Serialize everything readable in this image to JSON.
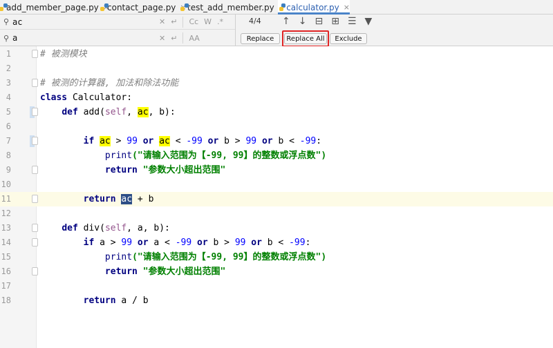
{
  "tabs": [
    {
      "label": "add_member_page.py",
      "close": "×"
    },
    {
      "label": "contact_page.py",
      "close": "×"
    },
    {
      "label": "test_add_member.py",
      "close": "×"
    },
    {
      "label": "calculator.py",
      "close": "×"
    }
  ],
  "find": {
    "search_value": "ac",
    "replace_value": "a",
    "match_count": "4/4",
    "opt_cc": "Cc",
    "opt_w": "W",
    "opt_regex": ".*",
    "opt_aa": "AA",
    "replace_label": "Replace",
    "replace_all_label": "Replace All",
    "exclude_label": "Exclude"
  },
  "code": {
    "l1_comment": "# 被测模块",
    "l3_comment": "# 被测的计算器, 加法和除法功能",
    "class_kw": "class",
    "class_name": " Calculator:",
    "def_kw": "def",
    "add_name": "add",
    "self": "self",
    "ac": "ac",
    "b": "b",
    "if_kw": "if",
    "or_kw": "or",
    "print_kw": "print",
    "return_kw": "return",
    "num_99": "99",
    "num_neg99": "-99",
    "print_str": "(\"请输入范围为【-99, 99】的整数或浮点数\")",
    "return_str": "\"参数大小超出范围\"",
    "div_name": "div",
    "a": "a"
  },
  "line_numbers": [
    "1",
    "2",
    "3",
    "4",
    "5",
    "6",
    "7",
    "8",
    "9",
    "10",
    "11",
    "12",
    "13",
    "14",
    "15",
    "16",
    "17",
    "18"
  ]
}
